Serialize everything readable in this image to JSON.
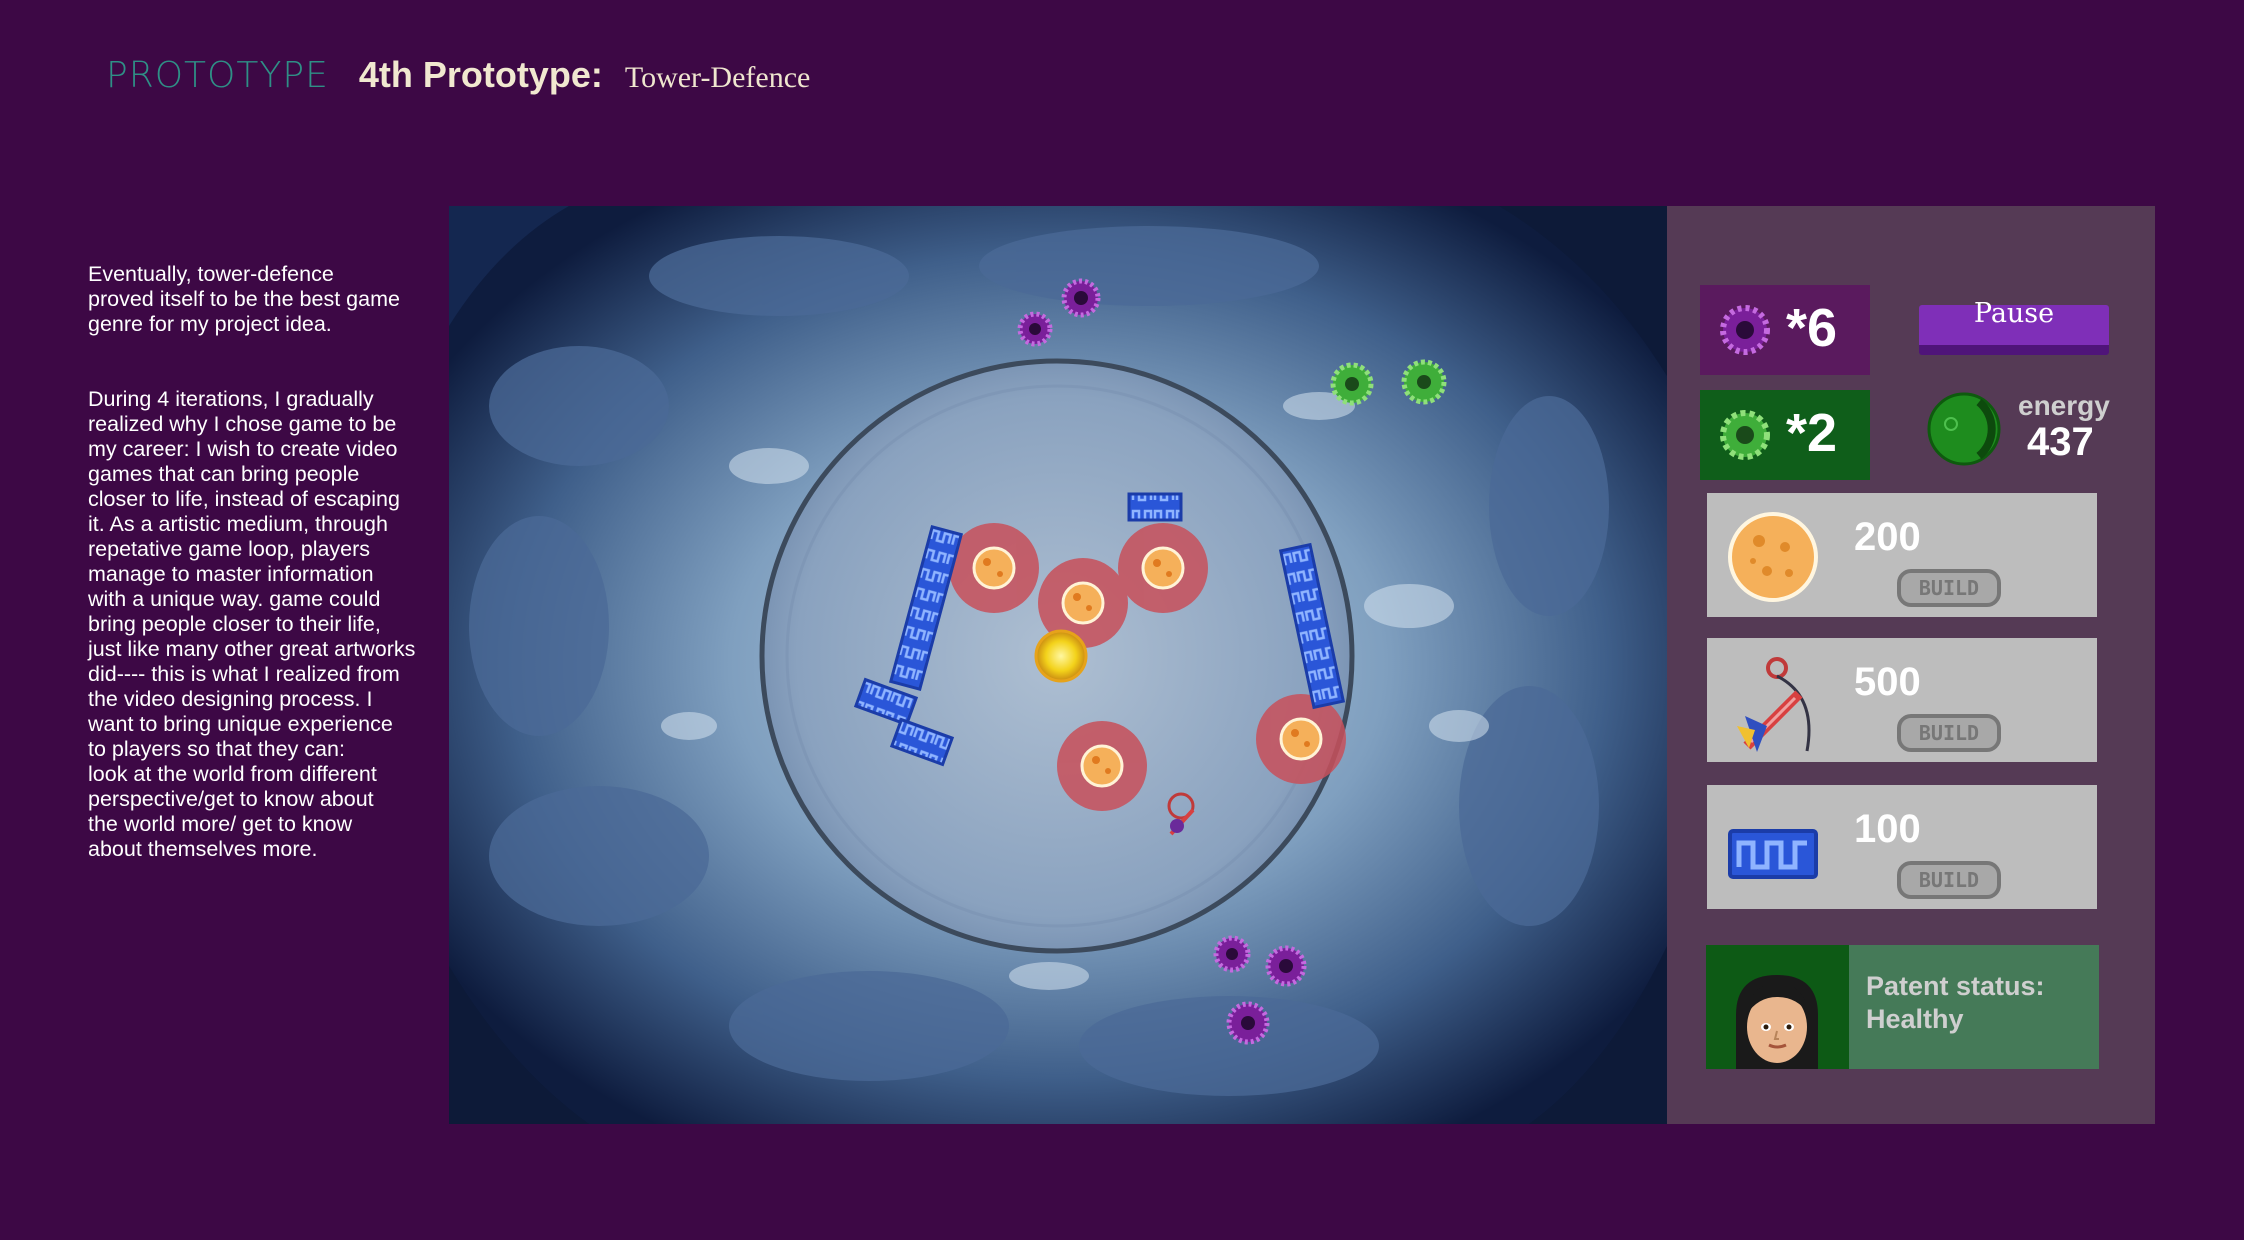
{
  "header": {
    "category": "PROTOTYPE",
    "title": "4th Prototype:",
    "subtitle": "Tower-Defence"
  },
  "description": {
    "paragraph_1": "Eventually, tower-defence\nproved itself to be the best  game\ngenre for my project idea.",
    "paragraph_2": "During 4 iterations, I gradually\nrealized why I chose game to be\nmy career:  I wish to create video\ngames that can  bring people\ncloser to life,  instead of escaping\nit. As a artistic medium,  through\nrepetative game loop, players\nmanage to master information\nwith a unique way. game could\nbring people closer to their life,\njust like many other great artworks\ndid---- this is what I realized from\nthe video designing process. I\nwant to bring unique experience\nto players so that  they can:\nlook at the world from  different\nperspective/get to know about\nthe world more/ get to know\nabout themselves more."
  },
  "hud": {
    "purple_virus_count": "*6",
    "green_virus_count": "*2",
    "pause_label": "Pause",
    "energy_label": "energy",
    "energy_value": "437"
  },
  "build_menu": [
    {
      "icon": "cell-tower-icon",
      "cost": "200",
      "button": "BUILD"
    },
    {
      "icon": "antibody-weapon-icon",
      "cost": "500",
      "button": "BUILD"
    },
    {
      "icon": "wall-barrier-icon",
      "cost": "100",
      "button": "BUILD"
    }
  ],
  "patient": {
    "status_label": "Patent status:",
    "status_value": "Healthy"
  },
  "colors": {
    "background": "#3d0845",
    "panel": "#553a55",
    "virus_purple": "#7a1f9a",
    "virus_green": "#3fae3a",
    "tower_range": "#c8505a",
    "barrier_blue": "#2a56d8"
  }
}
